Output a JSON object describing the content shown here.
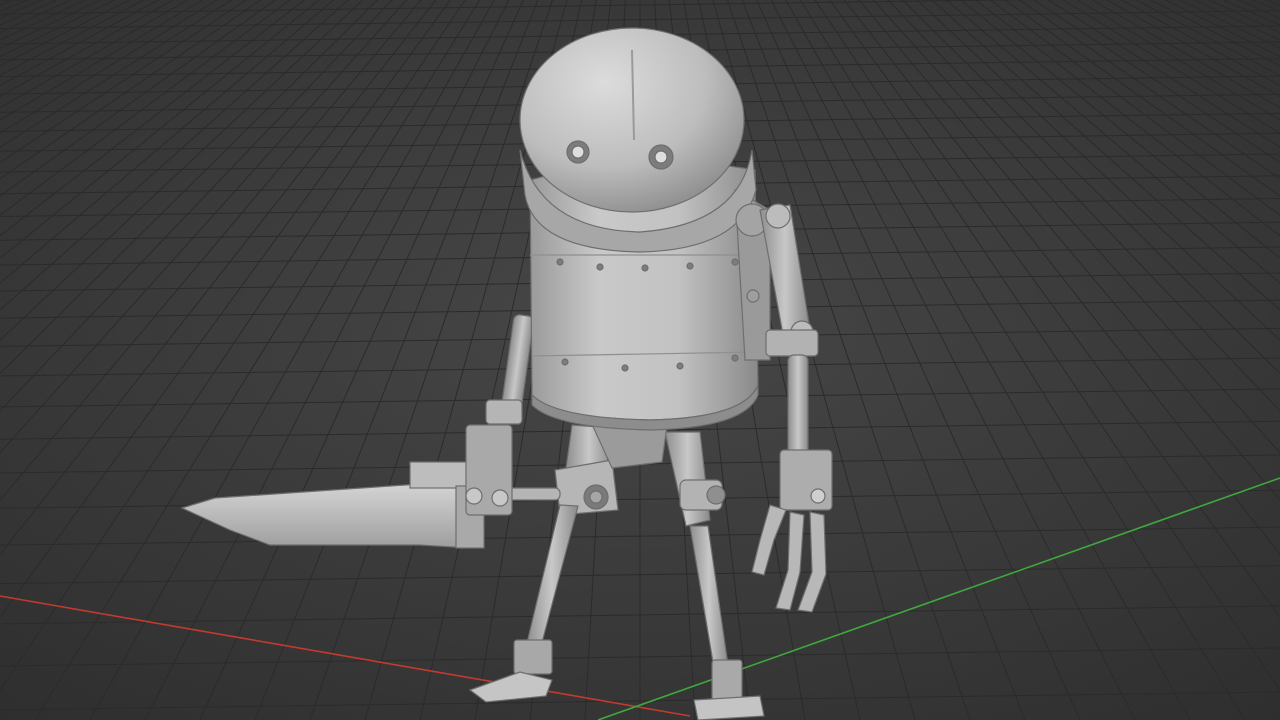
{
  "viewport": {
    "view": "perspective",
    "shading": "solid",
    "background_color": "#3a3a3a",
    "grid_color": "#2b2b2b",
    "x_axis_color": "#c43a2f",
    "y_axis_color": "#3fa83f",
    "model_color": "#b9b9b9"
  },
  "scene": {
    "object": "robot-model",
    "parts": [
      "head",
      "eyes",
      "body",
      "left-arm",
      "right-arm",
      "sword",
      "left-leg",
      "right-leg",
      "feet"
    ]
  }
}
